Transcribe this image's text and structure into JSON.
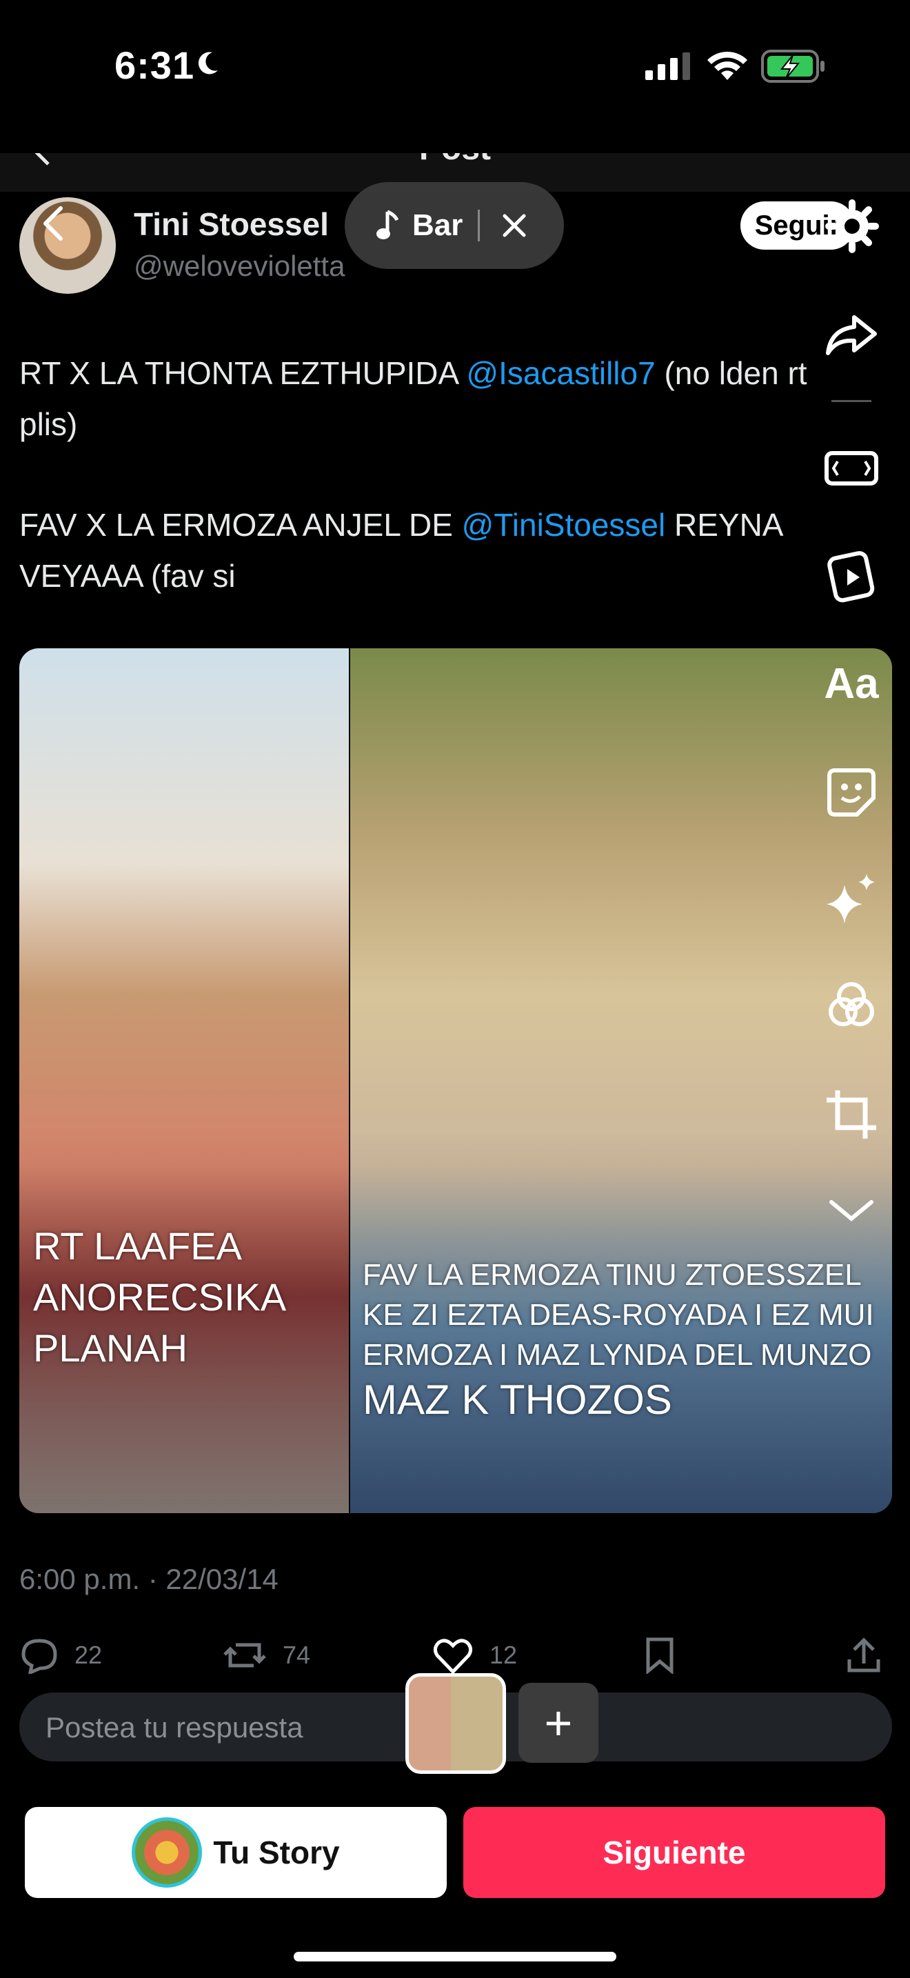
{
  "status_bar": {
    "time": "6:31",
    "battery_color": "#34c759"
  },
  "header": {
    "title": "Post"
  },
  "author": {
    "name": "Tini Stoessel",
    "handle": "@weloveviolettа"
  },
  "music": {
    "label": "Bar"
  },
  "follow_label": "Seguir",
  "tweet": {
    "p1_before": "RT X LA THONTA EZTHUPIDA ",
    "p1_mention": "@Isacastillo7",
    "p1_after": " (no lden rt plis)",
    "p2_before": "FAV X LA ERMOZA ANJEL DE ",
    "p2_mention": "@TiniStoessel",
    "p2_after": " REYNA VEYAAA (fav si"
  },
  "media": {
    "caption_left": "RT LAAFEA ANORECSIKA PLANAH",
    "caption_right": "FAV LA ERMOZA TINU ZTOESSZEL KE ZI EZTA DEAS-ROYADA I EZ MUI ERMOZA I MAZ LYNDA DEL MUNZO",
    "caption_right_tail": "MAZ K THOZOS"
  },
  "side_tools": {
    "text_tool": "Aa"
  },
  "timestamp": "6:00 p.m. · 22/03/14",
  "actions": {
    "replies": "22",
    "reposts": "74",
    "likes": "12"
  },
  "reply": {
    "placeholder": "Postea tu respuesta"
  },
  "bottom": {
    "story_label": "Tu Story",
    "next_label": "Siguiente",
    "add_label": "+"
  },
  "colors": {
    "accent": "#fe2c55",
    "mention": "#1d9bf0",
    "muted": "#71767b"
  }
}
